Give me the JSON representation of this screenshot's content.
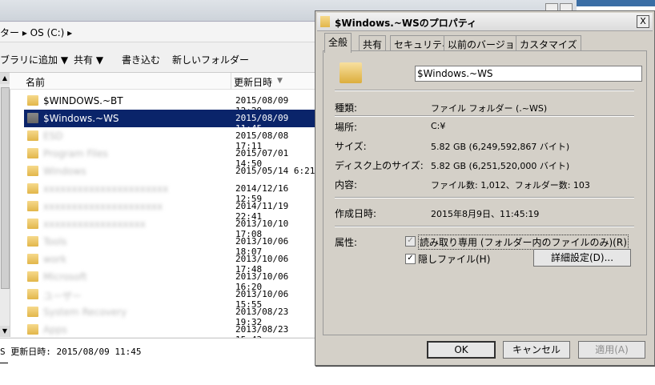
{
  "explorer": {
    "address": "ター ▸ OS (C:) ▸",
    "commands": [
      "ブラリに追加 ▼",
      "共有 ▼",
      "書き込む",
      "新しいフォルダー"
    ],
    "columns": {
      "name": "名前",
      "date": "更新日時"
    },
    "rows": [
      {
        "name": "$WINDOWS.~BT",
        "date": "2015/08/09 12:29"
      },
      {
        "name": "$Windows.~WS",
        "date": "2015/08/09 11:45"
      },
      {
        "name": "ESD",
        "date": "2015/08/08 17:11"
      },
      {
        "name": "Program Files",
        "date": "2015/07/01 14:50"
      },
      {
        "name": "Windows",
        "date": "2015/05/14 6:21"
      },
      {
        "name": "xxxxxxxxxxxxxxxxxxxxxx",
        "date": "2014/12/16 12:59"
      },
      {
        "name": "xxxxxxxxxxxxxxxxxxxxx",
        "date": "2014/11/19 22:41"
      },
      {
        "name": "xxxxxxxxxxxxxxxxxx",
        "date": "2013/10/10 17:08"
      },
      {
        "name": "Tools",
        "date": "2013/10/06 18:07"
      },
      {
        "name": "work",
        "date": "2013/10/06 17:48"
      },
      {
        "name": "Microsoft",
        "date": "2013/10/06 16:20"
      },
      {
        "name": "ユーザー",
        "date": "2013/10/06 15:55"
      },
      {
        "name": "System Recovery",
        "date": "2013/08/23 19:32"
      },
      {
        "name": "Apps",
        "date": "2013/08/23 15:43"
      }
    ],
    "details": "S 更新日時: 2015/08/09 11:45"
  },
  "dialog": {
    "title": "$Windows.~WSのプロパティ",
    "close": "X",
    "tabs": [
      "全般",
      "共有",
      "セキュリティ",
      "以前のバージョン",
      "カスタマイズ"
    ],
    "name_value": "$Windows.~WS",
    "props": {
      "type_label": "種類:",
      "type_value": "ファイル フォルダー (.~WS)",
      "location_label": "場所:",
      "location_value": "C:¥",
      "size_label": "サイズ:",
      "size_value": "5.82 GB (6,249,592,867 バイト)",
      "disk_label": "ディスク上のサイズ:",
      "disk_value": "5.82 GB (6,251,520,000 バイト)",
      "contents_label": "内容:",
      "contents_value": "ファイル数: 1,012、フォルダー数: 103",
      "created_label": "作成日時:",
      "created_value": "2015年8月9日、11:45:19",
      "attr_label": "属性:"
    },
    "readonly_label": "読み取り専用 (フォルダー内のファイルのみ)(R)",
    "hidden_label": "隠しファイル(H)",
    "advanced_button": "詳細設定(D)...",
    "ok": "OK",
    "cancel": "キャンセル",
    "apply": "適用(A)"
  }
}
